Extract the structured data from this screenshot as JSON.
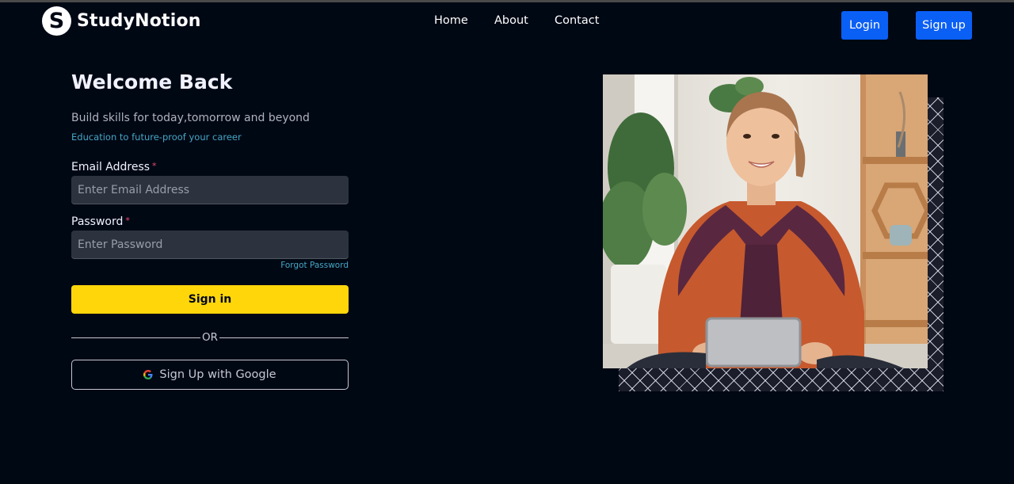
{
  "navbar": {
    "logo_letter": "S",
    "logo_text": "StudyNotion",
    "links": [
      "Home",
      "About",
      "Contact"
    ],
    "login_label": "Login",
    "signup_label": "Sign up"
  },
  "form": {
    "title": "Welcome Back",
    "subtitle": "Build skills for today,tomorrow and beyond",
    "tagline": "Education to future-proof your career",
    "email": {
      "label": "Email Address",
      "required_mark": "*",
      "placeholder": "Enter Email Address",
      "value": ""
    },
    "password": {
      "label": "Password",
      "required_mark": "*",
      "placeholder": "Enter Password",
      "value": ""
    },
    "forgot_label": "Forgot Password",
    "signin_label": "Sign in",
    "divider_text": "OR",
    "google_label": "Sign Up with Google"
  },
  "icons": {
    "logo": "studynotion-logo-icon",
    "google": "google-icon"
  },
  "colors": {
    "background": "#000814",
    "accent_yellow": "#FFD60A",
    "nav_button_blue": "#0a5ff5",
    "link_blue": "#47A5C5",
    "input_bg": "#2C333F",
    "required": "#EF476F"
  }
}
